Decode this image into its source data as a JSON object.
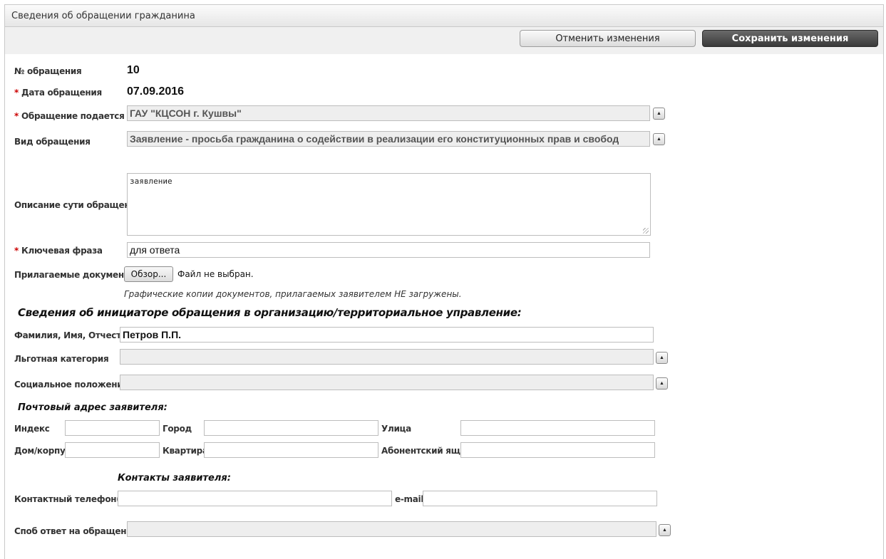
{
  "panel": {
    "title": "Сведения об обращении гражданина"
  },
  "toolbar": {
    "cancel_label": "Отменить изменения",
    "save_label": "Сохранить изменения"
  },
  "appeal": {
    "number_label": "№ обращения",
    "number_value": "10",
    "date_label": "Дата обращения",
    "date_value": "07.09.2016",
    "submitted_to_label": "Обращение подается в",
    "submitted_to_value": "ГАУ \"КЦСОН г. Кушвы\"",
    "type_label": "Вид обращения",
    "type_value": "Заявление - просьба гражданина о содействии в реализации его конституционных прав и свобод",
    "description_label": "Описание сути обращения",
    "description_value": "заявление",
    "keyphrase_label": "Ключевая фраза",
    "keyphrase_value": "для ответа",
    "attachments_label": "Прилагаемые документы",
    "browse_label": "Обзор...",
    "file_status": "Файл не выбран.",
    "attachments_note": "Графические копии документов, прилагаемых заявителем НЕ загружены."
  },
  "initiator": {
    "section_title": "Сведения об инициаторе обращения в организацию/территориальное управление:",
    "fio_label": "Фамилия, Имя, Отчество",
    "fio_value": "Петров П.П.",
    "benefit_label": "Льготная категория",
    "benefit_value": "",
    "social_label": "Социальное положение",
    "social_value": ""
  },
  "address": {
    "title": "Почтовый адрес заявителя:",
    "index_label": "Индекс",
    "city_label": "Город",
    "street_label": "Улица",
    "house_label": "Дом/корпус",
    "apartment_label": "Квартира",
    "pobox_label": "Абонентский ящик"
  },
  "contacts": {
    "title": "Контакты заявителя:",
    "phone_label": "Контактный телефон(ы)",
    "email_label": "e-mail",
    "reply_method_label": "Споб ответ на обращение",
    "reply_method_value": ""
  },
  "colors": {
    "required": "#cc0000",
    "disabled_bg": "#eeeeee",
    "save_button": "#3a3a3a"
  }
}
